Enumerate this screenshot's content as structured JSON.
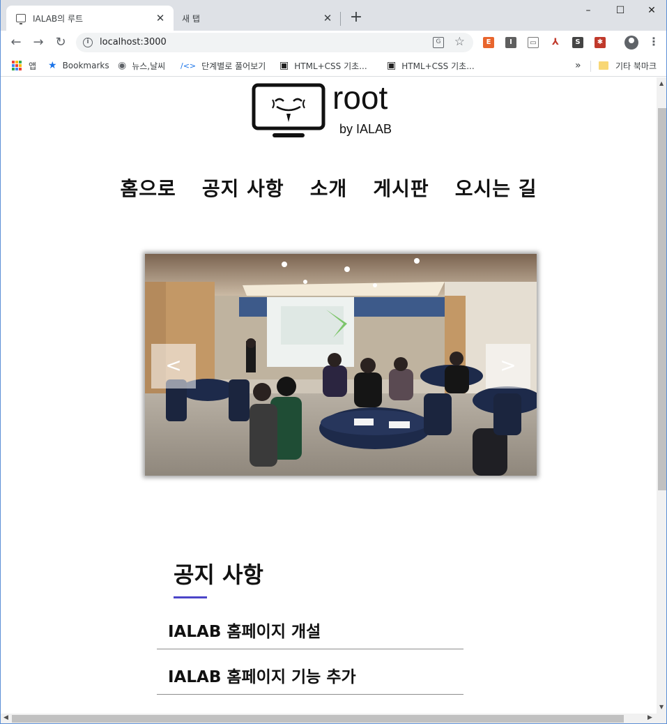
{
  "browser": {
    "tabs": [
      {
        "title": "IALAB의 루트",
        "close": "✕"
      },
      {
        "title": "새 탭",
        "close": "✕"
      }
    ],
    "new_tab": "+",
    "window_controls": {
      "minimize": "–",
      "maximize": "☐",
      "close": "✕"
    },
    "url": "localhost:3000",
    "bookmarks": [
      {
        "label": "앱",
        "icon": "apps-icon"
      },
      {
        "label": "Bookmarks",
        "icon": "star-icon"
      },
      {
        "label": "뉴스,날씨",
        "icon": "globe-icon"
      },
      {
        "label": "단계별로 풀어보기",
        "icon": "code-icon"
      },
      {
        "label": "HTML+CSS 기초...",
        "icon": "comment-icon"
      },
      {
        "label": "HTML+CSS 기초...",
        "icon": "comment-icon"
      }
    ],
    "bookmarks_more": "»",
    "other_bookmarks": "기타 북마크"
  },
  "site": {
    "logo": {
      "name": "root",
      "tagline": "by IALAB"
    },
    "nav": [
      "홈으로",
      "공지 사항",
      "소개",
      "게시판",
      "오시는 길"
    ],
    "slider": {
      "prev": "<",
      "next": ">"
    },
    "notice": {
      "title": "공지 사항",
      "items": [
        "IALAB 홈페이지 개설",
        "IALAB 홈페이지 기능 추가"
      ]
    }
  },
  "colors": {
    "accent": "#4b45c8",
    "chrome_bg": "#dee1e6"
  }
}
